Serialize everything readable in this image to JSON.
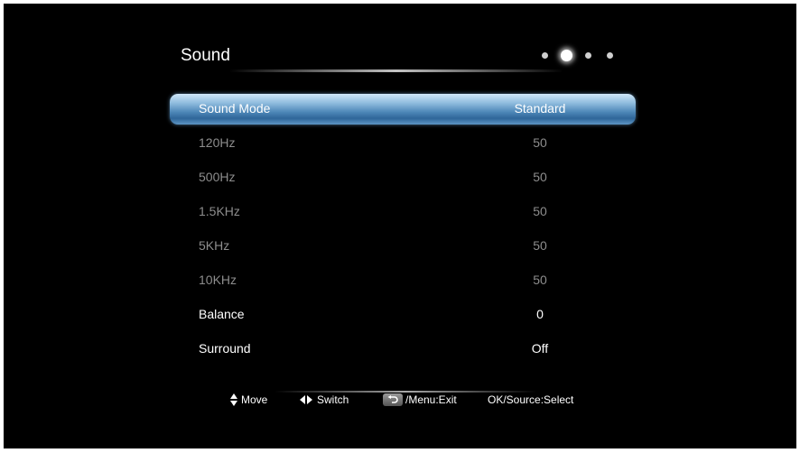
{
  "menu": {
    "title": "Sound",
    "page_dots": {
      "count": 4,
      "active_index": 1
    }
  },
  "settings": [
    {
      "label": "Sound Mode",
      "value": "Standard",
      "state": "selected"
    },
    {
      "label": "120Hz",
      "value": "50",
      "state": "disabled"
    },
    {
      "label": "500Hz",
      "value": "50",
      "state": "disabled"
    },
    {
      "label": "1.5KHz",
      "value": "50",
      "state": "disabled"
    },
    {
      "label": "5KHz",
      "value": "50",
      "state": "disabled"
    },
    {
      "label": "10KHz",
      "value": "50",
      "state": "disabled"
    },
    {
      "label": "Balance",
      "value": "0",
      "state": "enabled"
    },
    {
      "label": "Surround",
      "value": "Off",
      "state": "enabled"
    }
  ],
  "hints": {
    "move": "Move",
    "switch": "Switch",
    "exit": "/Menu:Exit",
    "select": "OK/Source:Select"
  },
  "colors": {
    "background": "#000000",
    "selection_highlight": "#4c86b7",
    "disabled_text": "#8d8d8d",
    "enabled_text": "#ffffff"
  }
}
